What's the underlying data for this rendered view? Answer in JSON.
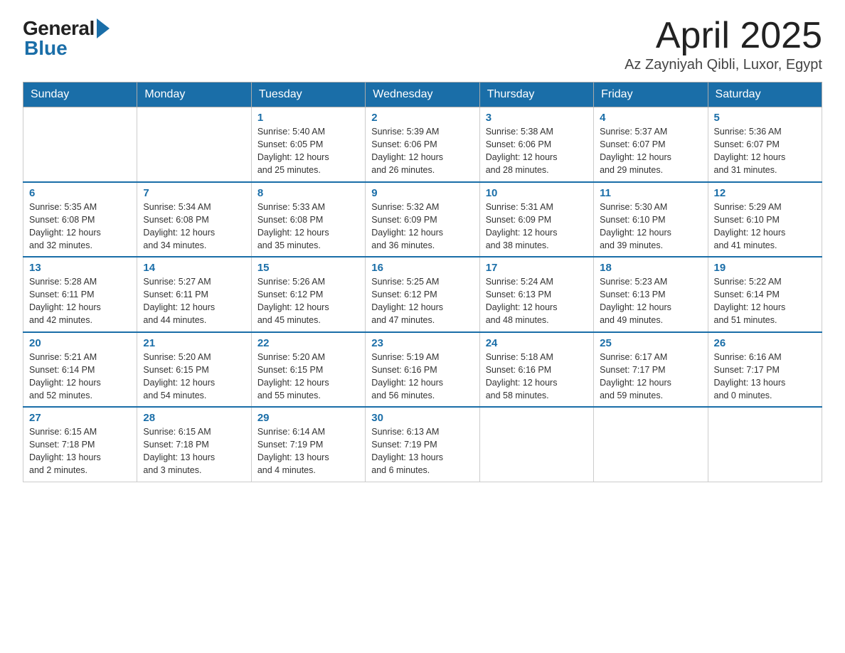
{
  "header": {
    "month_title": "April 2025",
    "location": "Az Zayniyah Qibli, Luxor, Egypt"
  },
  "logo": {
    "general": "General",
    "blue": "Blue"
  },
  "weekdays": [
    "Sunday",
    "Monday",
    "Tuesday",
    "Wednesday",
    "Thursday",
    "Friday",
    "Saturday"
  ],
  "weeks": [
    [
      {
        "day": "",
        "info": ""
      },
      {
        "day": "",
        "info": ""
      },
      {
        "day": "1",
        "info": "Sunrise: 5:40 AM\nSunset: 6:05 PM\nDaylight: 12 hours\nand 25 minutes."
      },
      {
        "day": "2",
        "info": "Sunrise: 5:39 AM\nSunset: 6:06 PM\nDaylight: 12 hours\nand 26 minutes."
      },
      {
        "day": "3",
        "info": "Sunrise: 5:38 AM\nSunset: 6:06 PM\nDaylight: 12 hours\nand 28 minutes."
      },
      {
        "day": "4",
        "info": "Sunrise: 5:37 AM\nSunset: 6:07 PM\nDaylight: 12 hours\nand 29 minutes."
      },
      {
        "day": "5",
        "info": "Sunrise: 5:36 AM\nSunset: 6:07 PM\nDaylight: 12 hours\nand 31 minutes."
      }
    ],
    [
      {
        "day": "6",
        "info": "Sunrise: 5:35 AM\nSunset: 6:08 PM\nDaylight: 12 hours\nand 32 minutes."
      },
      {
        "day": "7",
        "info": "Sunrise: 5:34 AM\nSunset: 6:08 PM\nDaylight: 12 hours\nand 34 minutes."
      },
      {
        "day": "8",
        "info": "Sunrise: 5:33 AM\nSunset: 6:08 PM\nDaylight: 12 hours\nand 35 minutes."
      },
      {
        "day": "9",
        "info": "Sunrise: 5:32 AM\nSunset: 6:09 PM\nDaylight: 12 hours\nand 36 minutes."
      },
      {
        "day": "10",
        "info": "Sunrise: 5:31 AM\nSunset: 6:09 PM\nDaylight: 12 hours\nand 38 minutes."
      },
      {
        "day": "11",
        "info": "Sunrise: 5:30 AM\nSunset: 6:10 PM\nDaylight: 12 hours\nand 39 minutes."
      },
      {
        "day": "12",
        "info": "Sunrise: 5:29 AM\nSunset: 6:10 PM\nDaylight: 12 hours\nand 41 minutes."
      }
    ],
    [
      {
        "day": "13",
        "info": "Sunrise: 5:28 AM\nSunset: 6:11 PM\nDaylight: 12 hours\nand 42 minutes."
      },
      {
        "day": "14",
        "info": "Sunrise: 5:27 AM\nSunset: 6:11 PM\nDaylight: 12 hours\nand 44 minutes."
      },
      {
        "day": "15",
        "info": "Sunrise: 5:26 AM\nSunset: 6:12 PM\nDaylight: 12 hours\nand 45 minutes."
      },
      {
        "day": "16",
        "info": "Sunrise: 5:25 AM\nSunset: 6:12 PM\nDaylight: 12 hours\nand 47 minutes."
      },
      {
        "day": "17",
        "info": "Sunrise: 5:24 AM\nSunset: 6:13 PM\nDaylight: 12 hours\nand 48 minutes."
      },
      {
        "day": "18",
        "info": "Sunrise: 5:23 AM\nSunset: 6:13 PM\nDaylight: 12 hours\nand 49 minutes."
      },
      {
        "day": "19",
        "info": "Sunrise: 5:22 AM\nSunset: 6:14 PM\nDaylight: 12 hours\nand 51 minutes."
      }
    ],
    [
      {
        "day": "20",
        "info": "Sunrise: 5:21 AM\nSunset: 6:14 PM\nDaylight: 12 hours\nand 52 minutes."
      },
      {
        "day": "21",
        "info": "Sunrise: 5:20 AM\nSunset: 6:15 PM\nDaylight: 12 hours\nand 54 minutes."
      },
      {
        "day": "22",
        "info": "Sunrise: 5:20 AM\nSunset: 6:15 PM\nDaylight: 12 hours\nand 55 minutes."
      },
      {
        "day": "23",
        "info": "Sunrise: 5:19 AM\nSunset: 6:16 PM\nDaylight: 12 hours\nand 56 minutes."
      },
      {
        "day": "24",
        "info": "Sunrise: 5:18 AM\nSunset: 6:16 PM\nDaylight: 12 hours\nand 58 minutes."
      },
      {
        "day": "25",
        "info": "Sunrise: 6:17 AM\nSunset: 7:17 PM\nDaylight: 12 hours\nand 59 minutes."
      },
      {
        "day": "26",
        "info": "Sunrise: 6:16 AM\nSunset: 7:17 PM\nDaylight: 13 hours\nand 0 minutes."
      }
    ],
    [
      {
        "day": "27",
        "info": "Sunrise: 6:15 AM\nSunset: 7:18 PM\nDaylight: 13 hours\nand 2 minutes."
      },
      {
        "day": "28",
        "info": "Sunrise: 6:15 AM\nSunset: 7:18 PM\nDaylight: 13 hours\nand 3 minutes."
      },
      {
        "day": "29",
        "info": "Sunrise: 6:14 AM\nSunset: 7:19 PM\nDaylight: 13 hours\nand 4 minutes."
      },
      {
        "day": "30",
        "info": "Sunrise: 6:13 AM\nSunset: 7:19 PM\nDaylight: 13 hours\nand 6 minutes."
      },
      {
        "day": "",
        "info": ""
      },
      {
        "day": "",
        "info": ""
      },
      {
        "day": "",
        "info": ""
      }
    ]
  ]
}
